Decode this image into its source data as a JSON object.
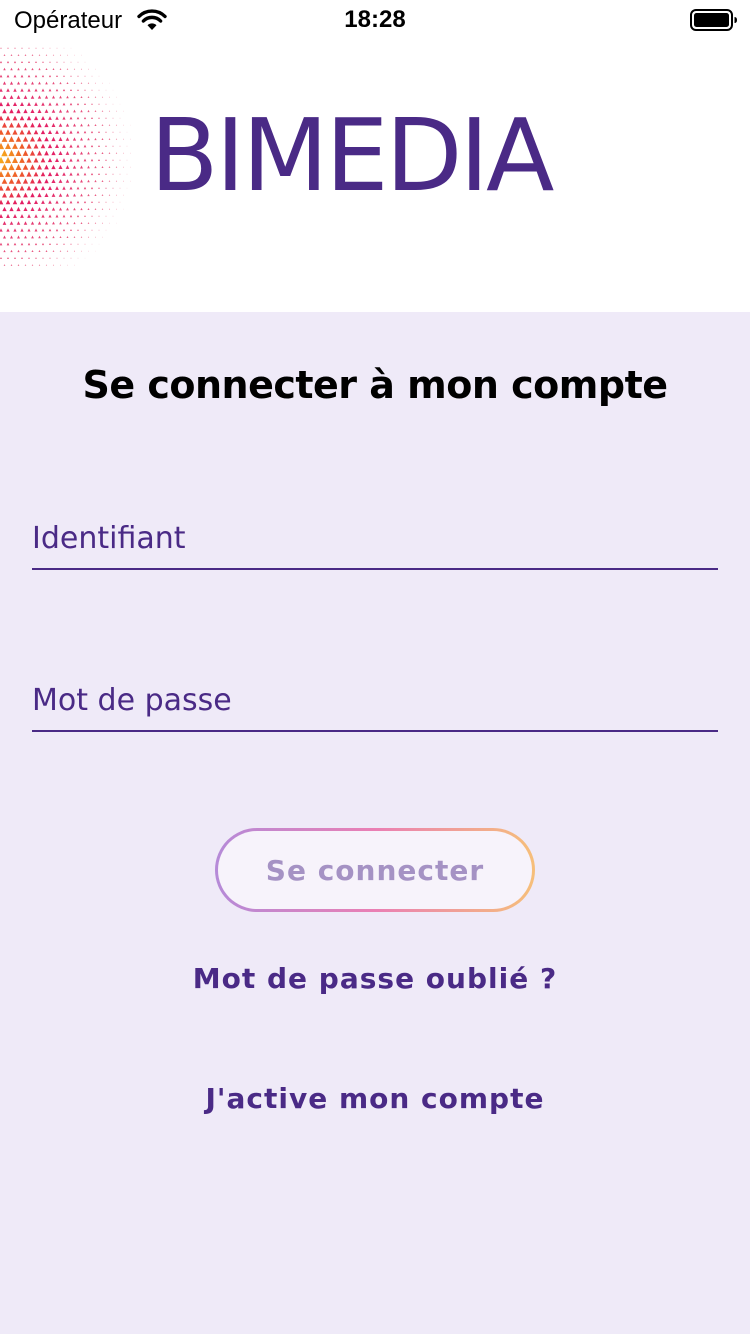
{
  "status_bar": {
    "carrier": "Opérateur",
    "time": "18:28",
    "wifi_icon": "wifi-icon",
    "battery_icon": "battery-icon"
  },
  "header": {
    "brand_name": "BIMEDIA",
    "logo_icon": "gradient-triangle-pattern-logo"
  },
  "login": {
    "title": "Se connecter à mon compte",
    "username_placeholder": "Identifiant",
    "password_placeholder": "Mot de passe",
    "submit_label": "Se connecter",
    "forgot_password_label": "Mot de passe oublié ?",
    "activate_account_label": "J'active mon compte"
  },
  "colors": {
    "brand": "#4a2a86",
    "background": "#efeaf8",
    "button_gradient": [
      "#b58ad8",
      "#ea7fb4",
      "#f6bf7a"
    ],
    "button_text_disabled": "#a592c4"
  }
}
